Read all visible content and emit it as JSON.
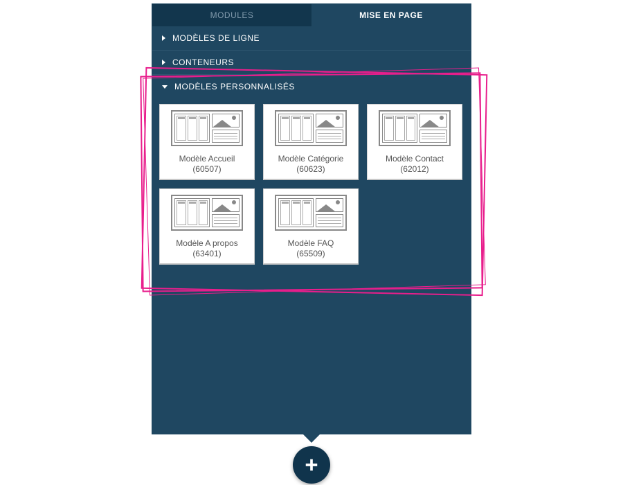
{
  "tabs": {
    "modules": "MODULES",
    "layout": "MISE EN PAGE"
  },
  "sections": {
    "row_templates": "MODÈLES DE LIGNE",
    "containers": "CONTENEURS",
    "custom_templates": "MODÈLES PERSONNALISÉS"
  },
  "templates": [
    {
      "name": "Modèle Accueil",
      "id": "60507"
    },
    {
      "name": "Modèle Catégorie",
      "id": "60623"
    },
    {
      "name": "Modèle Contact",
      "id": "62012"
    },
    {
      "name": "Modèle A propos",
      "id": "63401"
    },
    {
      "name": "Modèle FAQ",
      "id": "65509"
    }
  ],
  "colors": {
    "highlight": "#e81e8c",
    "panel_bg": "#1f4761",
    "tab_inactive_bg": "#12364d"
  }
}
